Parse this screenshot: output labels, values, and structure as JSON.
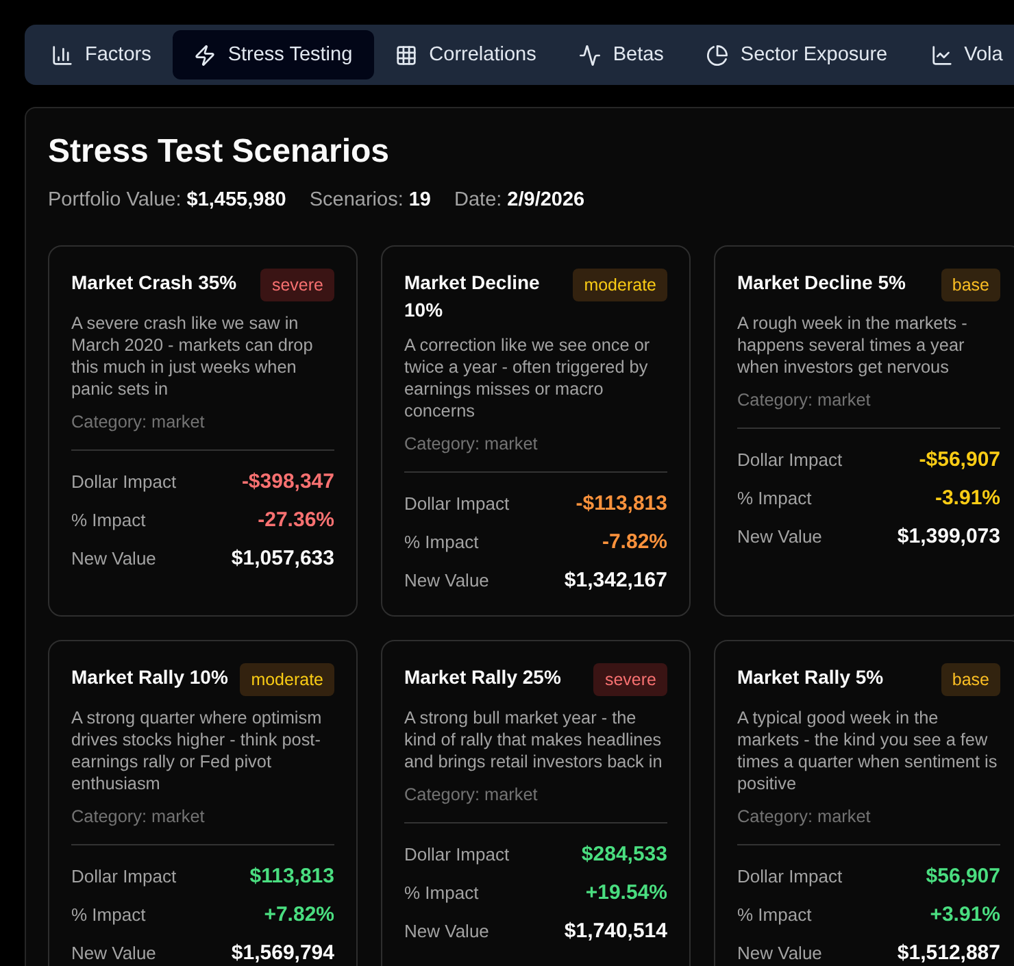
{
  "tabs": [
    {
      "label": "Factors",
      "kind": "bars",
      "selected": false
    },
    {
      "label": "Stress Testing",
      "kind": "bolt",
      "selected": true
    },
    {
      "label": "Correlations",
      "kind": "grid",
      "selected": false
    },
    {
      "label": "Betas",
      "kind": "pulse",
      "selected": false
    },
    {
      "label": "Sector Exposure",
      "kind": "pie",
      "selected": false
    },
    {
      "label": "Vola",
      "kind": "line",
      "selected": false
    }
  ],
  "panel": {
    "title": "Stress Test Scenarios",
    "summary": [
      {
        "label": "Portfolio Value:",
        "value": "$1,455,980"
      },
      {
        "label": "Scenarios:",
        "value": "19"
      },
      {
        "label": "Date:",
        "value": "2/9/2026"
      }
    ],
    "scenarios": [
      {
        "title": "Market Crash 35%",
        "badge": {
          "label": "severe",
          "kind": "severe"
        },
        "description": "A severe crash like we saw in March 2020 - markets can drop this much in just weeks when panic sets in",
        "category": "Category: market",
        "metrics": [
          {
            "label": "Dollar Impact",
            "value": "-$398,347",
            "color": "#f87171"
          },
          {
            "label": "% Impact",
            "value": "-27.36%",
            "color": "#f87171"
          },
          {
            "label": "New Value",
            "value": "$1,057,633"
          }
        ]
      },
      {
        "title": "Market Decline 10%",
        "badge": {
          "label": "moderate",
          "kind": "moderate"
        },
        "description": "A correction like we see once or twice a year - often triggered by earnings misses or macro concerns",
        "category": "Category: market",
        "metrics": [
          {
            "label": "Dollar Impact",
            "value": "-$113,813",
            "color": "#fb923c"
          },
          {
            "label": "% Impact",
            "value": "-7.82%",
            "color": "#fb923c"
          },
          {
            "label": "New Value",
            "value": "$1,342,167"
          }
        ]
      },
      {
        "title": "Market Decline 5%",
        "badge": {
          "label": "base",
          "kind": "base"
        },
        "description": "A rough week in the markets - happens several times a year when investors get nervous",
        "category": "Category: market",
        "metrics": [
          {
            "label": "Dollar Impact",
            "value": "-$56,907",
            "color": "#facc15"
          },
          {
            "label": "% Impact",
            "value": "-3.91%",
            "color": "#facc15"
          },
          {
            "label": "New Value",
            "value": "$1,399,073"
          }
        ]
      },
      {
        "title": "Market Rally 10%",
        "badge": {
          "label": "moderate",
          "kind": "moderate"
        },
        "description": "A strong quarter where optimism drives stocks higher - think post-earnings rally or Fed pivot enthusiasm",
        "category": "Category: market",
        "metrics": [
          {
            "label": "Dollar Impact",
            "value": "$113,813",
            "color": "#4ade80"
          },
          {
            "label": "% Impact",
            "value": "+7.82%",
            "color": "#4ade80"
          },
          {
            "label": "New Value",
            "value": "$1,569,794"
          }
        ]
      },
      {
        "title": "Market Rally 25%",
        "badge": {
          "label": "severe",
          "kind": "severe"
        },
        "description": "A strong bull market year - the kind of rally that makes headlines and brings retail investors back in",
        "category": "Category: market",
        "metrics": [
          {
            "label": "Dollar Impact",
            "value": "$284,533",
            "color": "#4ade80"
          },
          {
            "label": "% Impact",
            "value": "+19.54%",
            "color": "#4ade80"
          },
          {
            "label": "New Value",
            "value": "$1,740,514"
          }
        ]
      },
      {
        "title": "Market Rally 5%",
        "badge": {
          "label": "base",
          "kind": "base"
        },
        "description": "A typical good week in the markets - the kind you see a few times a quarter when sentiment is positive",
        "category": "Category: market",
        "metrics": [
          {
            "label": "Dollar Impact",
            "value": "$56,907",
            "color": "#4ade80"
          },
          {
            "label": "% Impact",
            "value": "+3.91%",
            "color": "#4ade80"
          },
          {
            "label": "New Value",
            "value": "$1,512,887"
          }
        ]
      }
    ]
  }
}
